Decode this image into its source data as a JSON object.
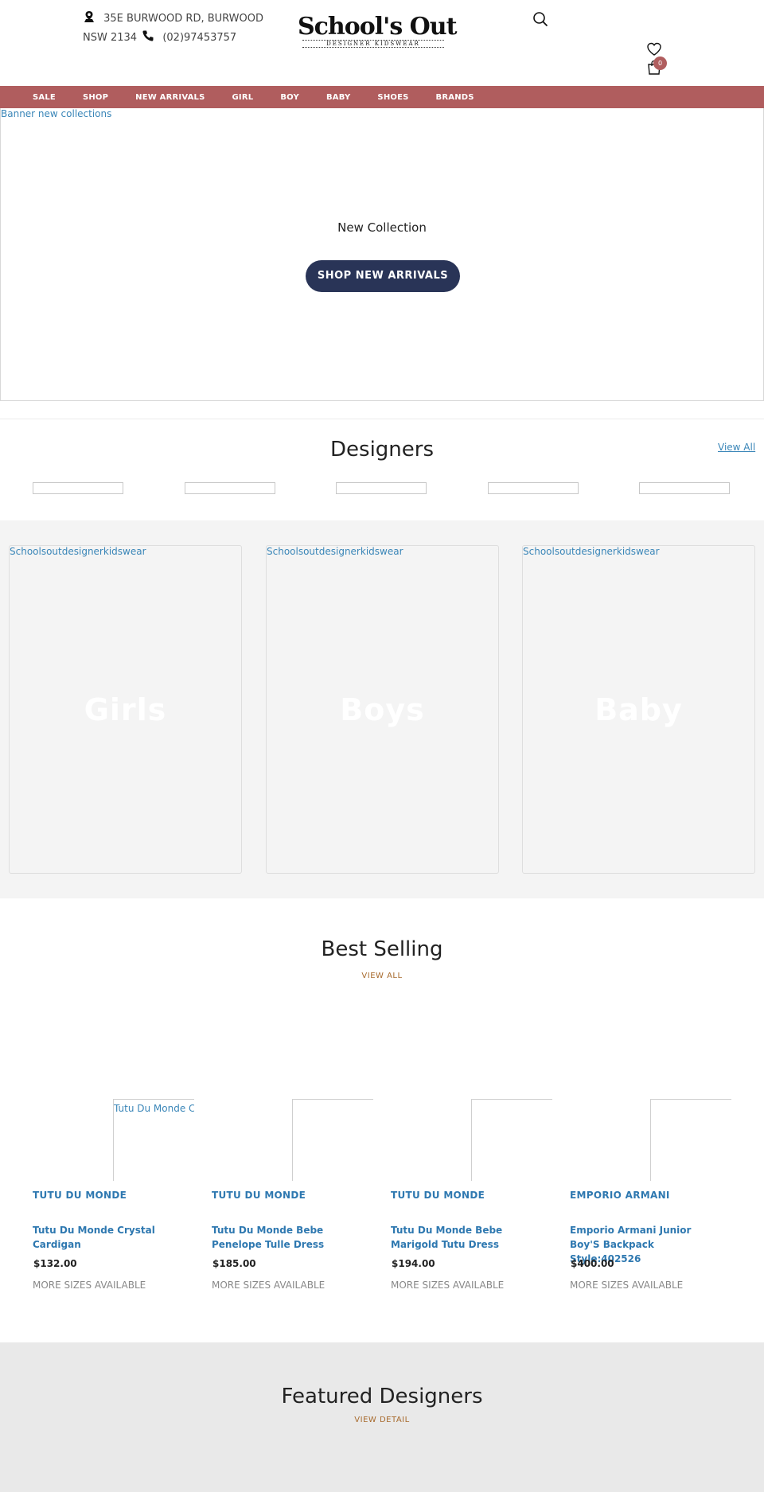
{
  "header": {
    "address": "35E BURWOOD RD, BURWOOD NSW 2134",
    "phone": "(02)97453757",
    "logo_main": "School's Out",
    "logo_sub": "DESIGNER KIDSWEAR",
    "cart_count": "0"
  },
  "nav": {
    "items": [
      "SALE",
      "SHOP",
      "NEW ARRIVALS",
      "GIRL",
      "BOY",
      "BABY",
      "SHOES",
      "BRANDS"
    ]
  },
  "banner": {
    "alt_text": "Banner new collections",
    "title": "New Collection",
    "button_label": "SHOP NEW ARRIVALS",
    "button_color": "#293457"
  },
  "designers": {
    "title": "Designers",
    "view_all": "View All"
  },
  "categories": [
    {
      "alt_text": "Schoolsoutdesignerkidswear",
      "label": "Girls"
    },
    {
      "alt_text": "Schoolsoutdesignerkidswear",
      "label": "Boys"
    },
    {
      "alt_text": "Schoolsoutdesignerkidswear",
      "label": "Baby"
    }
  ],
  "best_selling": {
    "title": "Best Selling",
    "view_all": "VIEW ALL",
    "products": [
      {
        "image_alt": "Tutu Du Monde C",
        "brand": "TUTU DU MONDE",
        "name": "Tutu Du Monde Crystal Cardigan",
        "price": "$132.00",
        "sizes": "MORE SIZES AVAILABLE"
      },
      {
        "image_alt": "",
        "brand": "TUTU DU MONDE",
        "name": "Tutu Du Monde Bebe Penelope Tulle Dress",
        "price": "$185.00",
        "sizes": "MORE SIZES AVAILABLE"
      },
      {
        "image_alt": "",
        "brand": "TUTU DU MONDE",
        "name": "Tutu Du Monde Bebe Marigold Tutu Dress",
        "price": "$194.00",
        "sizes": "MORE SIZES AVAILABLE"
      },
      {
        "image_alt": "",
        "brand": "EMPORIO ARMANI",
        "name": "Emporio Armani Junior Boy'S Backpack Style:402526",
        "price": "$400.00",
        "sizes": "MORE SIZES AVAILABLE"
      }
    ]
  },
  "featured": {
    "title": "Featured Designers",
    "link": "VIEW DETAIL"
  },
  "colors": {
    "nav_bg": "#b05d5e",
    "link_blue": "#2e78b0",
    "accent_brown": "#a86b2e"
  }
}
